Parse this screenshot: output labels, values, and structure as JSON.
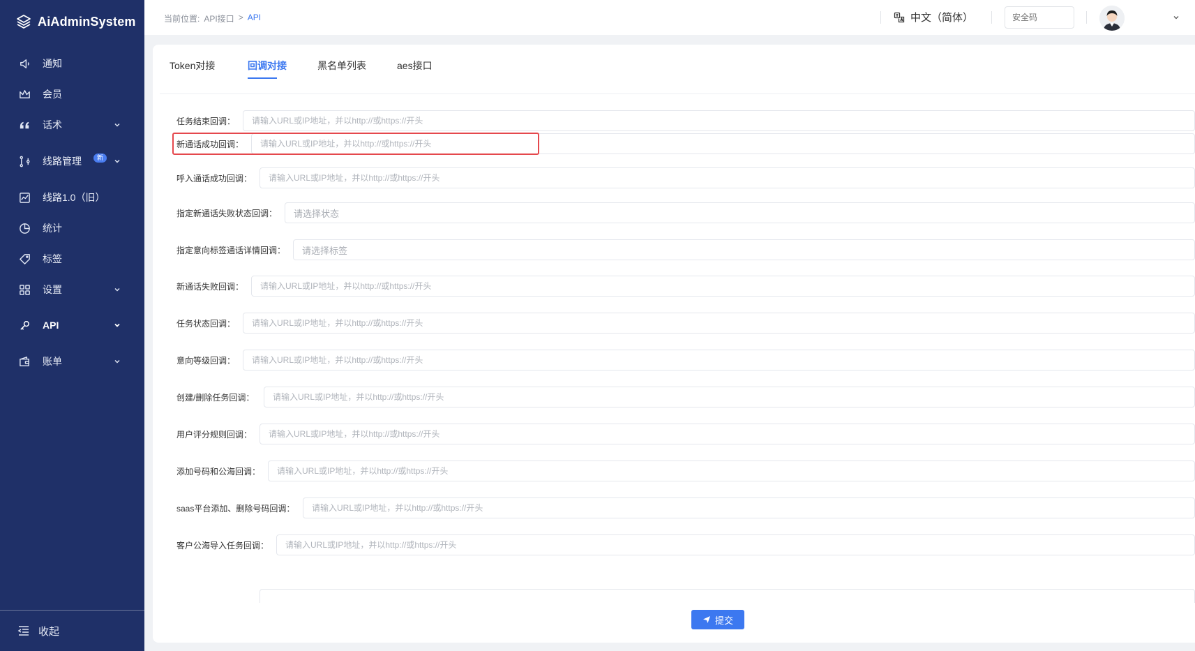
{
  "app": {
    "title": "AiAdminSystem"
  },
  "sidebar": {
    "items": [
      {
        "label": "通知",
        "icon": "speaker-icon"
      },
      {
        "label": "会员",
        "icon": "crown-icon"
      },
      {
        "label": "话术",
        "icon": "quote-icon"
      },
      {
        "label": "线路管理",
        "icon": "route-icon",
        "badge": "新"
      },
      {
        "label": "线路1.0（旧）",
        "icon": "line-chart-icon"
      },
      {
        "label": "统计",
        "icon": "pie-chart-icon"
      },
      {
        "label": "标签",
        "icon": "tag-icon"
      },
      {
        "label": "设置",
        "icon": "grid-icon"
      },
      {
        "label": "API",
        "icon": "api-icon"
      },
      {
        "label": "账单",
        "icon": "wallet-icon"
      }
    ],
    "collapse_label": "收起"
  },
  "header": {
    "breadcrumb": {
      "prefix": "当前位置:",
      "parent": "API接口",
      "separator": ">",
      "current": "API"
    },
    "language": "中文（简体）",
    "security_placeholder": "安全码"
  },
  "tabs": [
    "Token对接",
    "回调对接",
    "黑名单列表",
    "aes接口"
  ],
  "active_tab": "回调对接",
  "form": {
    "fields": [
      {
        "label": "任务结束回调：",
        "placeholder": "请输入URL或IP地址，并以http://或https://开头"
      },
      {
        "label": "新通话成功回调：",
        "placeholder": "请输入URL或IP地址，并以http://或https://开头"
      },
      {
        "label": "呼入通话成功回调：",
        "placeholder": "请输入URL或IP地址，并以http://或https://开头"
      },
      {
        "label": "指定新通话失败状态回调：",
        "placeholder": "请选择状态"
      },
      {
        "label": "指定意向标签通话详情回调：",
        "placeholder": "请选择标签"
      },
      {
        "label": "新通话失败回调：",
        "placeholder": "请输入URL或IP地址，并以http://或https://开头"
      },
      {
        "label": "任务状态回调：",
        "placeholder": "请输入URL或IP地址，并以http://或https://开头"
      },
      {
        "label": "意向等级回调：",
        "placeholder": "请输入URL或IP地址，并以http://或https://开头"
      },
      {
        "label": "创建/删除任务回调：",
        "placeholder": "请输入URL或IP地址，并以http://或https://开头"
      },
      {
        "label": "用户评分规则回调：",
        "placeholder": "请输入URL或IP地址，并以http://或https://开头"
      },
      {
        "label": "添加号码和公海回调：",
        "placeholder": "请输入URL或IP地址，并以http://或https://开头"
      },
      {
        "label": "saas平台添加、删除号码回调：",
        "placeholder": "请输入URL或IP地址，并以http://或https://开头"
      },
      {
        "label": "客户公海导入任务回调：",
        "placeholder": "请输入URL或IP地址，并以http://或https://开头"
      }
    ],
    "submit_label": "提交"
  },
  "colors": {
    "sidebar_bg": "#1f3068",
    "accent": "#3c78f0",
    "highlight": "#e5484d"
  }
}
